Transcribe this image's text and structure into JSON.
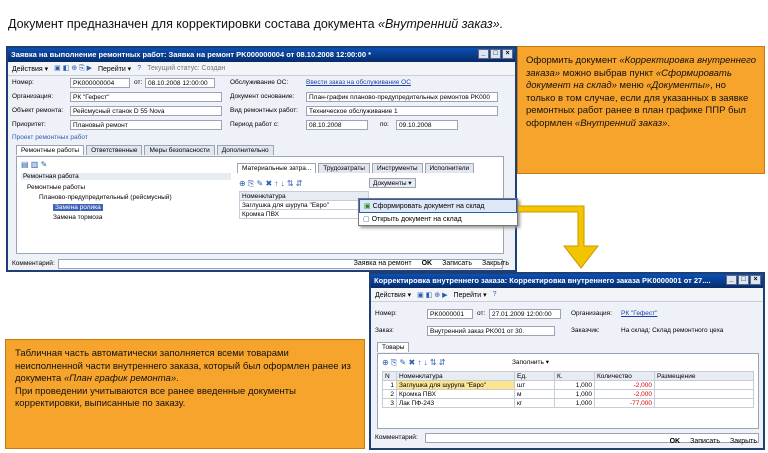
{
  "heading": {
    "prefix": "Документ предназначен для корректировки состава документа ",
    "doc_name": "«Внутренний заказ»."
  },
  "win1": {
    "title": "Заявка на выполнение ремонтных работ: Заявка на ремонт PK000000004 от 08.10.2008 12:00:00 *",
    "toolbar": {
      "actions": "Действия ▾",
      "goto": "Перейти ▾",
      "status_label": "Текущий статус: Создан"
    },
    "fields": {
      "number_label": "Номер:",
      "number": "PK000000004",
      "date_label": "от:",
      "date": "08.10.2008 12:00:00",
      "org_label": "Организация:",
      "org": "РК \"Гефест\"",
      "object_label": "Объект ремонта:",
      "object": "Рейсмусный станок D 55 Nova",
      "priority_label": "Приоритет:",
      "priority": "Плановый ремонт",
      "service_label": "Обслуживание ОС:",
      "service_link": "Ввести заказ на обслуживание ОС",
      "base_label": "Документ основание:",
      "base": "План-график планово-предупредительных ремонтов PK000",
      "kind_label": "Вид ремонтных работ:",
      "kind": "Техническое обслуживание 1",
      "period_label": "Период работ с:",
      "period_from": "08.10.2008",
      "period_to_label": "по:",
      "period_to": "09.10.2008"
    },
    "project": "Проект ремонтных работ",
    "tabs": [
      "Ремонтные работы",
      "Ответственные",
      "Меры безопасности",
      "Дополнительно"
    ],
    "tree": {
      "header": "Ремонтная работа",
      "items": [
        "Ремонтные работы",
        "Планово-предупредительный (рейсмусный)",
        "Замена ролика",
        "Замена тормоза"
      ]
    },
    "right_tabs": [
      "Материальные затра...",
      "Трудозатраты",
      "Инструменты",
      "Исполнители"
    ],
    "documents_btn": "Документы ▾",
    "nom_header": "Номенклатура",
    "nom_rows": [
      "Заглушка для шурупа \"Евро\"",
      "Кромка ПВХ"
    ],
    "menu": [
      "Сформировать документ на склад",
      "Открыть документ на склад"
    ],
    "comment_label": "Комментарий:",
    "bottom": [
      "Заявка на ремонт",
      "OK",
      "Записать",
      "Закрыть"
    ]
  },
  "win2": {
    "title": "Корректировка внутреннего заказа: Корректировка внутреннего заказа PK0000001 от 27....",
    "toolbar": {
      "actions": "Действия ▾",
      "goto": "Перейти ▾"
    },
    "fields": {
      "number_label": "Номер:",
      "number": "PK0000001",
      "date_label": "от:",
      "date": "27.01.2009 12:00:00",
      "org_label": "Организация:",
      "org": "РК \"Гефест\"",
      "order_label": "Заказ:",
      "order": "Внутренний заказ PK001 от 30.",
      "customer_label": "Заказчик:",
      "customer": "На склад: Склад ремонтного цеха"
    },
    "tab": "Товары",
    "fill_btn": "Заполнить ▾",
    "columns": [
      "N",
      "Номенклатура",
      "Ед.",
      "К.",
      "Количество",
      "Размещение"
    ],
    "rows": [
      {
        "n": "1",
        "nom": "Заглушка для шурупа \"Евро\"",
        "unit": "шт",
        "k": "1,000",
        "qty": "-2,000"
      },
      {
        "n": "2",
        "nom": "Кромка ПВХ",
        "unit": "м",
        "k": "1,000",
        "qty": "-2,000"
      },
      {
        "n": "3",
        "nom": "Лак ПФ-243",
        "unit": "кг",
        "k": "1,000",
        "qty": "-77,000"
      }
    ],
    "comment_label": "Комментарий:",
    "bottom": [
      "OK",
      "Записать",
      "Закрыть"
    ]
  },
  "callout1": {
    "t1": "Оформить документ ",
    "i1": "«Корректировка внутреннего заказа»",
    "t2": " можно выбрав пункт ",
    "i2": "«Сформировать документ на склад»",
    "t3": " меню ",
    "i3": "«Документы»",
    "t4": ", но только в том случае, если для указанных в заявке ремонтных работ ранее в план графике ППР был оформлен ",
    "i4": "«Внутренний заказ»",
    "t5": "."
  },
  "callout2": {
    "t1": "Табличная часть автоматически заполняется всеми товарами неисполненной части внутреннего заказа, который был оформлен ранее из документа ",
    "i1": "«План график ремонта»",
    "t2": ".",
    "t3": "При проведении учитываются все ранее введенные документы корректировки, выписанные по заказу."
  },
  "colors": {
    "callout": "#f6a42c",
    "arrow": "#f5c400",
    "title_bar": "#0b4fb3"
  }
}
